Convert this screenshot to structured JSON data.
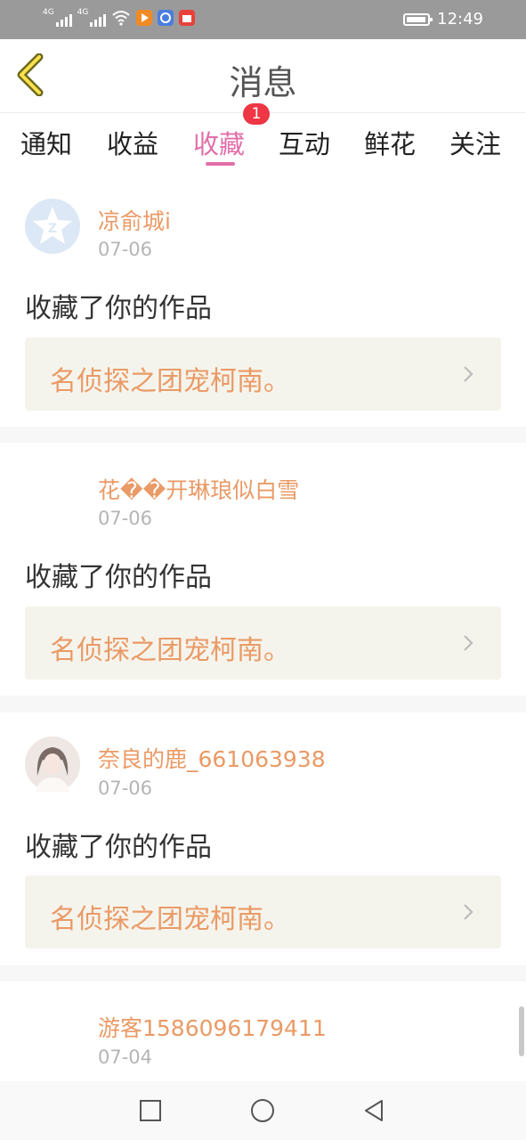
{
  "status_bar": {
    "signal_1_label": "4G",
    "signal_2_label": "4G",
    "time": "12:49",
    "app_icons": [
      "video-app-icon",
      "music-app-icon",
      "shopping-app-icon"
    ]
  },
  "header": {
    "title": "消息",
    "back_icon": "chevron-left-icon"
  },
  "tabs": {
    "items": [
      {
        "label": "通知"
      },
      {
        "label": "收益"
      },
      {
        "label": "收藏"
      },
      {
        "label": "互动"
      },
      {
        "label": "鲜花"
      },
      {
        "label": "关注"
      }
    ],
    "active_index": 2,
    "badge": "1"
  },
  "messages": [
    {
      "username": "凉俞城i",
      "date": "07-06",
      "action": "收藏了你的作品",
      "work": "名侦探之团宠柯南。",
      "avatar": "default-star-avatar"
    },
    {
      "username": "花��开琳琅似白雪",
      "date": "07-06",
      "action": "收藏了你的作品",
      "work": "名侦探之团宠柯南。",
      "avatar": "none"
    },
    {
      "username": "奈良的鹿_661063938",
      "date": "07-06",
      "action": "收藏了你的作品",
      "work": "名侦探之团宠柯南。",
      "avatar": "photo-avatar"
    },
    {
      "username": "游客1586096179411",
      "date": "07-04",
      "avatar": "none"
    }
  ],
  "colors": {
    "accent": "#e26fa9",
    "username": "#ea9a66",
    "badge": "#ee3645",
    "work_bg": "#f5f4ec"
  }
}
